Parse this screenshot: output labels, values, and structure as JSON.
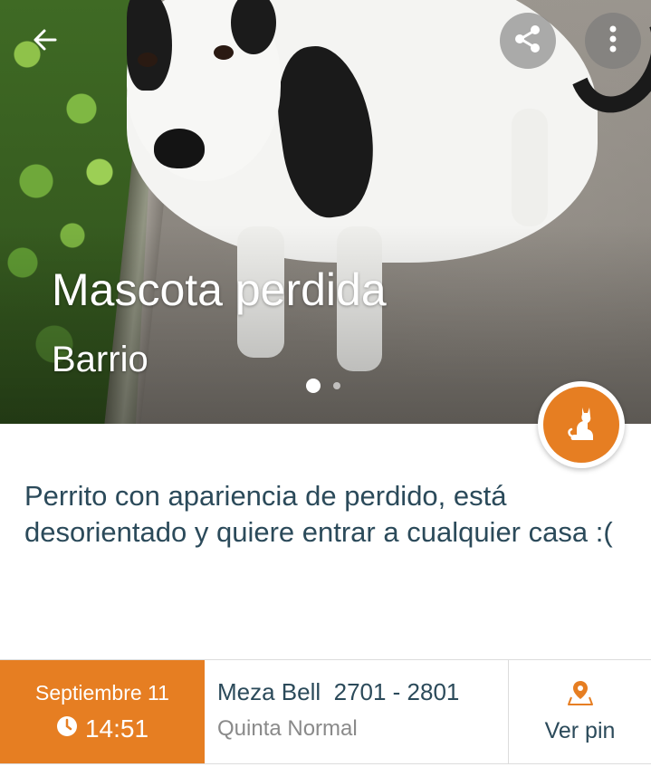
{
  "header": {
    "back_icon": "arrow-left-icon",
    "share_icon": "share-icon",
    "more_icon": "more-vertical-icon"
  },
  "hero": {
    "title": "Mascota perdida",
    "subtitle": "Barrio",
    "carousel": {
      "total_slides": 2,
      "active_slide": 1
    }
  },
  "category_button": {
    "icon": "cat-icon",
    "color": "#e67e22"
  },
  "report": {
    "description": "Perrito con apariencia de perdido, está desorientado y quiere entrar a cualquier casa :("
  },
  "info": {
    "date": "Septiembre 11",
    "time": "14:51",
    "clock_icon": "clock-icon",
    "street": "Meza Bell  2701 - 2801",
    "commune": "Quinta Normal",
    "pin_icon": "map-pin-icon",
    "pin_label": "Ver pin"
  },
  "colors": {
    "accent": "#e67e22",
    "text_primary": "#2b4a5a",
    "text_secondary": "#8a8a8a"
  }
}
